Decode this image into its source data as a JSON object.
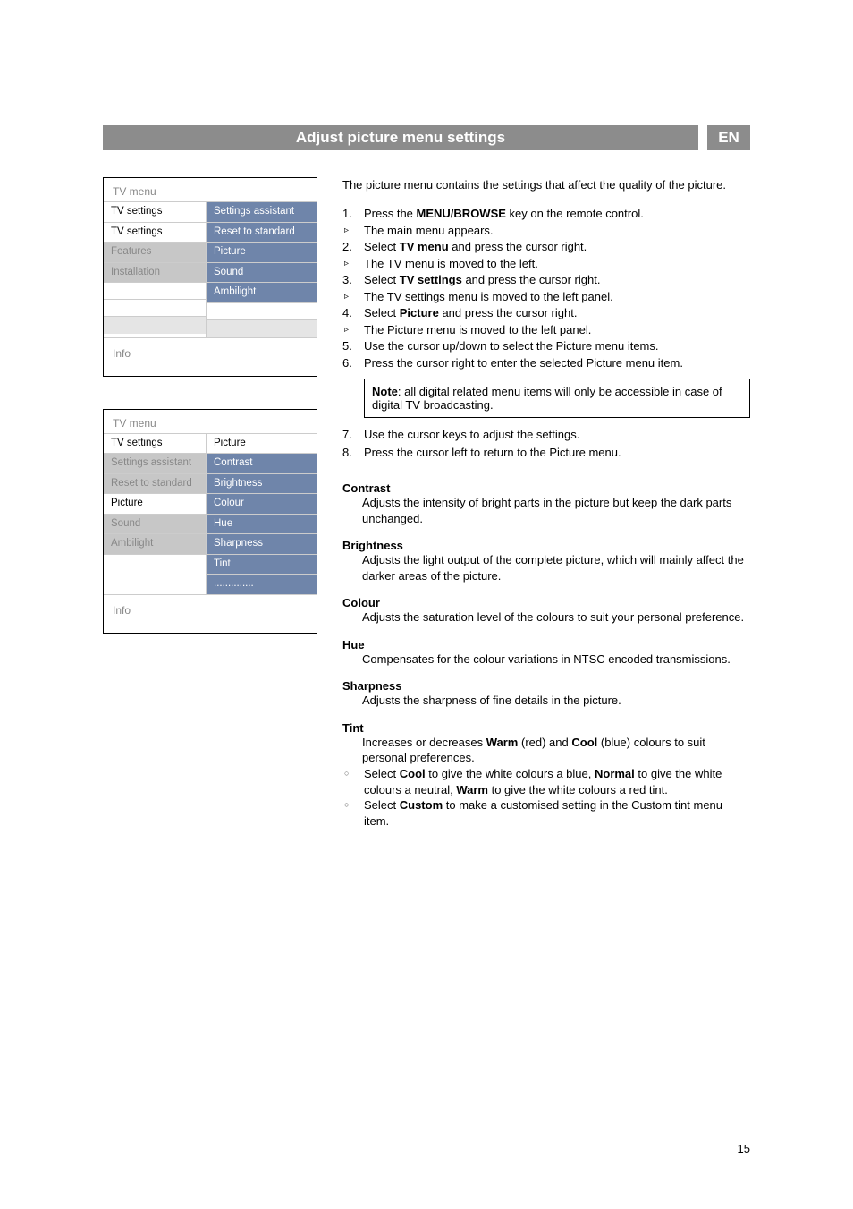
{
  "header": {
    "title": "Adjust picture menu settings",
    "lang": "EN"
  },
  "page_number": "15",
  "menu1": {
    "title": "TV menu",
    "left_heading": "TV settings",
    "left_items": [
      "TV settings",
      "Features",
      "Installation"
    ],
    "right_items": [
      "Settings assistant",
      "Reset to standard",
      "Picture",
      "Sound",
      "Ambilight"
    ],
    "info": "Info"
  },
  "menu2": {
    "title": "TV menu",
    "left_heading": "TV settings",
    "right_heading": "Picture",
    "left_items": [
      "Settings assistant",
      "Reset to standard",
      "Picture",
      "Sound",
      "Ambilight"
    ],
    "right_items": [
      "Contrast",
      "Brightness",
      "Colour",
      "Hue",
      "Sharpness",
      "Tint",
      ".............."
    ],
    "info": "Info"
  },
  "intro": "The picture menu contains the settings that affect the quality of the picture.",
  "steps": [
    {
      "n": "1.",
      "text_a": "Press the ",
      "bold": "MENU/BROWSE",
      "text_b": " key on the remote control.",
      "sub": "The main menu appears."
    },
    {
      "n": "2.",
      "text_a": "Select ",
      "bold": "TV menu",
      "text_b": " and press the cursor right.",
      "sub": "The TV menu is moved to the left."
    },
    {
      "n": "3.",
      "text_a": "Select ",
      "bold": "TV settings",
      "text_b": " and press the cursor right.",
      "sub": "The TV settings menu is moved to the left panel."
    },
    {
      "n": "4.",
      "text_a": "Select ",
      "bold": "Picture",
      "text_b": " and press the cursor right.",
      "sub": "The Picture menu is moved to the left panel."
    },
    {
      "n": "5.",
      "text": "Use the cursor up/down to select the Picture menu items."
    },
    {
      "n": "6.",
      "text": "Press the cursor right to enter the selected Picture menu item."
    }
  ],
  "note": {
    "bold": "Note",
    "text": ": all digital related menu items will only be accessible in case of digital TV broadcasting."
  },
  "steps2": [
    {
      "n": "7.",
      "text": "Use the cursor keys to adjust the settings."
    },
    {
      "n": "8.",
      "text": "Press the cursor left to return to the Picture menu."
    }
  ],
  "sect": {
    "contrast": {
      "t": "Contrast",
      "d": "Adjusts the intensity of bright parts in the picture but keep the dark parts unchanged."
    },
    "brightness": {
      "t": "Brightness",
      "d": "Adjusts the light output of the complete picture, which will mainly affect the darker areas of the picture."
    },
    "colour": {
      "t": "Colour",
      "d": "Adjusts the saturation level of the colours to suit your personal preference."
    },
    "hue": {
      "t": "Hue",
      "d": "Compensates for the colour variations in NTSC encoded transmissions."
    },
    "sharpness": {
      "t": "Sharpness",
      "d": "Adjusts the sharpness of fine details in the picture."
    },
    "tint": {
      "t": "Tint",
      "d": {
        "a": "Increases or decreases ",
        "b1": "Warm",
        "c": " (red) and ",
        "b2": "Cool",
        "e": " (blue) colours to suit personal preferences."
      },
      "b1": {
        "a": "Select ",
        "b": "Cool",
        "c": " to give the white colours a blue, ",
        "d": "Normal",
        "e": " to give the white colours a neutral, ",
        "f": "Warm",
        "g": " to give the white colours a red tint."
      },
      "b2": {
        "a": "Select ",
        "b": "Custom",
        "c": " to make a customised setting in the Custom tint menu item."
      }
    }
  }
}
